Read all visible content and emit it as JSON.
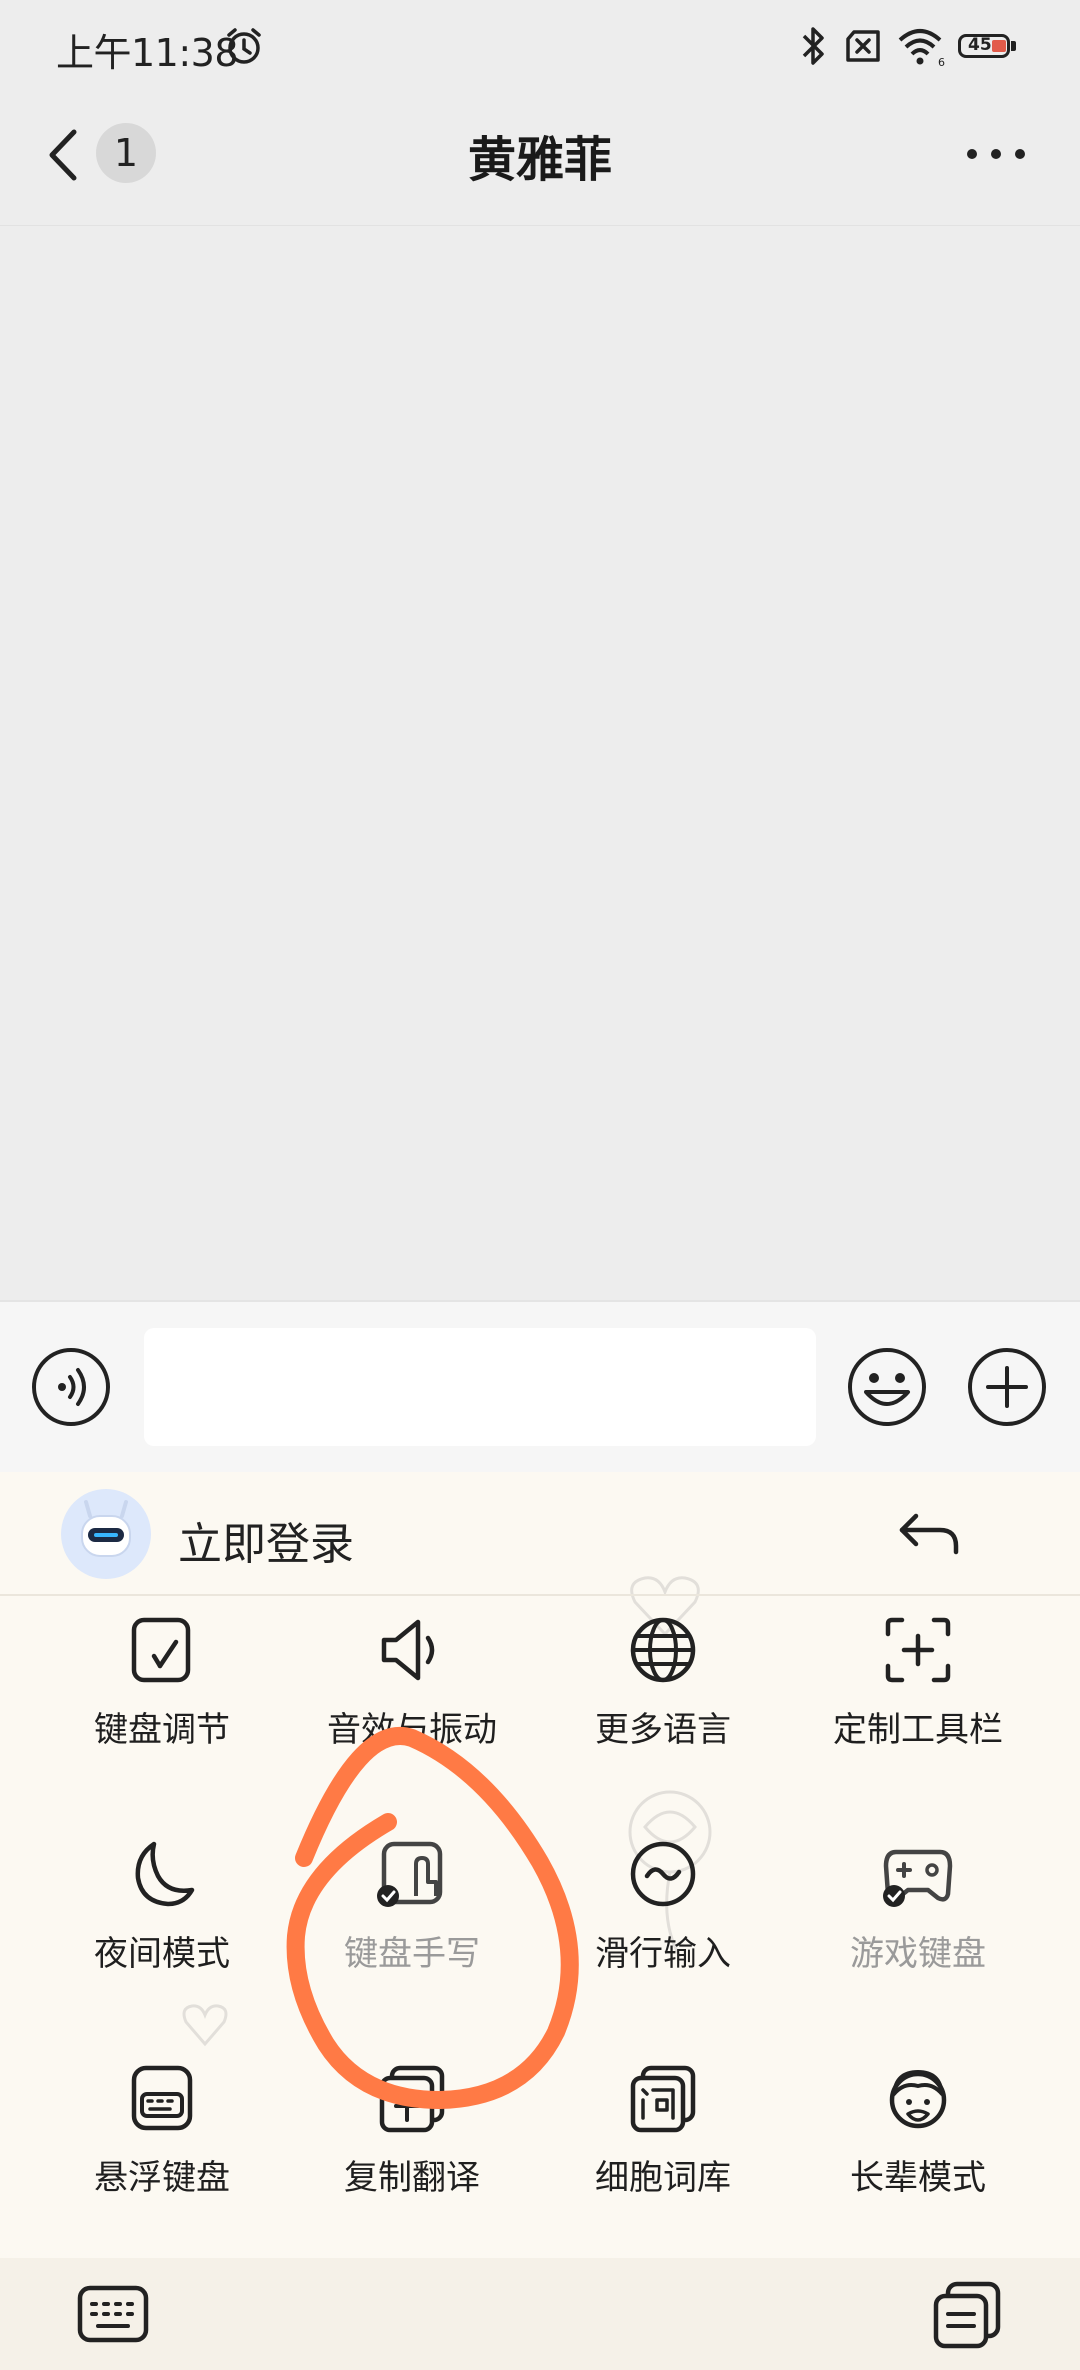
{
  "status_bar": {
    "time": "上午11:38",
    "battery": "45",
    "icons": [
      "alarm-icon",
      "bluetooth-icon",
      "sim-off-icon",
      "wifi-icon",
      "battery-icon"
    ]
  },
  "header": {
    "back_icon": "chevron-left-icon",
    "unread_count": "1",
    "title": "黄雅菲",
    "more_icon": "more-horizontal-icon"
  },
  "input_bar": {
    "voice_icon": "voice-icon",
    "message_value": "",
    "emoji_icon": "emoji-icon",
    "plus_icon": "plus-circle-icon"
  },
  "keyboard_panel": {
    "login_label": "立即登录",
    "avatar_icon": "robot-avatar-icon",
    "undo_icon": "undo-icon",
    "tools": [
      {
        "label": "键盘调节",
        "icon": "keyboard-adjust-icon",
        "enabled": true
      },
      {
        "label": "音效与振动",
        "icon": "speaker-icon",
        "enabled": true
      },
      {
        "label": "更多语言",
        "icon": "globe-icon",
        "enabled": true
      },
      {
        "label": "定制工具栏",
        "icon": "customize-toolbar-icon",
        "enabled": true
      },
      {
        "label": "夜间模式",
        "icon": "moon-icon",
        "enabled": true
      },
      {
        "label": "键盘手写",
        "icon": "handwriting-icon",
        "enabled": false
      },
      {
        "label": "滑行输入",
        "icon": "swipe-input-icon",
        "enabled": true
      },
      {
        "label": "游戏键盘",
        "icon": "gamepad-icon",
        "enabled": false
      },
      {
        "label": "悬浮键盘",
        "icon": "floating-keyboard-icon",
        "enabled": true
      },
      {
        "label": "复制翻译",
        "icon": "copy-translate-icon",
        "enabled": true
      },
      {
        "label": "细胞词库",
        "icon": "cell-dictionary-icon",
        "enabled": true
      },
      {
        "label": "长辈模式",
        "icon": "elder-mode-icon",
        "enabled": true
      }
    ],
    "bottom_left_icon": "keyboard-icon",
    "bottom_right_icon": "clipboard-icon"
  },
  "colors": {
    "annotation_stroke": "#ff7a45",
    "panel_bg": "#fcf9f2",
    "chat_bg": "#ededed"
  }
}
